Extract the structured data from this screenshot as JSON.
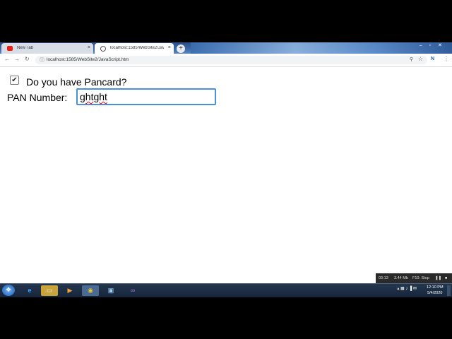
{
  "browser": {
    "tabs": [
      {
        "title": "New Tab",
        "close": "×"
      },
      {
        "title": "localhost:1585/WebSite2/JavaScr",
        "close": "×"
      }
    ],
    "new_tab": "+",
    "address": "localhost:1585/WebSite2/JavaScript.htm",
    "info_icon": "ⓘ",
    "zoom_icon": "⚲",
    "star_icon": "☆",
    "menu_icon": "⋮"
  },
  "form": {
    "checkbox_checked": true,
    "checkbox_mark": "✔",
    "question": "Do you have Pancard?",
    "pan_label": "PAN Number:",
    "pan_value": "ghtght"
  },
  "recorder": {
    "time": "03:13",
    "size": "3.44 Mb",
    "hint": "F10: Stop"
  },
  "taskbar": {
    "time": "12:10 PM",
    "date": "5/4/2020"
  }
}
